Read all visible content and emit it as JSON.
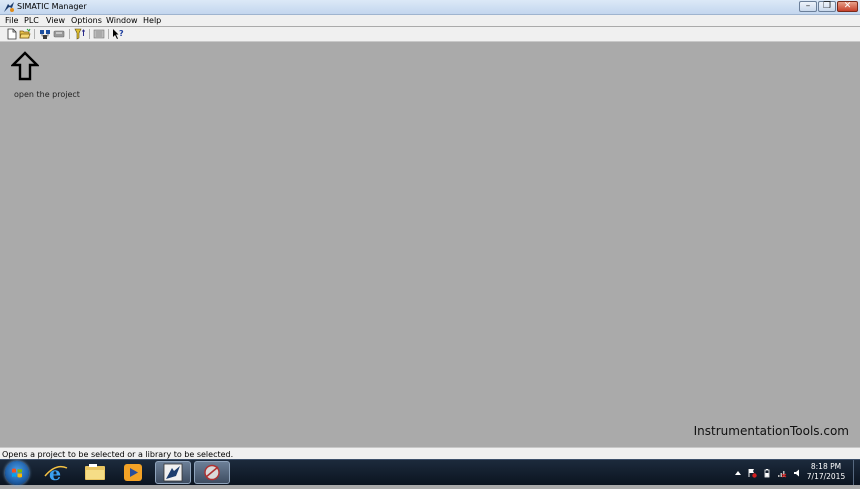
{
  "window": {
    "title": "SIMATIC Manager"
  },
  "menubar": {
    "items": [
      {
        "label": "File"
      },
      {
        "label": "PLC"
      },
      {
        "label": "View"
      },
      {
        "label": "Options"
      },
      {
        "label": "Window"
      },
      {
        "label": "Help"
      }
    ]
  },
  "toolbar": {
    "icons": [
      "new-project-icon",
      "open-project-icon",
      "accessible-nodes-icon",
      "memory-card-icon",
      "filter-icon",
      "simulation-icon",
      "help-icon"
    ]
  },
  "workspace": {
    "annotation": "open the project",
    "watermark": "InstrumentationTools.com"
  },
  "statusbar": {
    "text": "Opens a project to be selected or a library to be selected."
  },
  "taskbar": {
    "time": "8:18 PM",
    "date": "7/17/2015",
    "apps": [
      "internet-explorer-icon",
      "file-explorer-icon",
      "media-player-icon",
      "simatic-manager-icon",
      "sim-app-icon"
    ]
  },
  "colors": {
    "workspace": "#aaaaaa",
    "titlebar": "#c3d6ee",
    "taskbar": "#0b1420"
  }
}
